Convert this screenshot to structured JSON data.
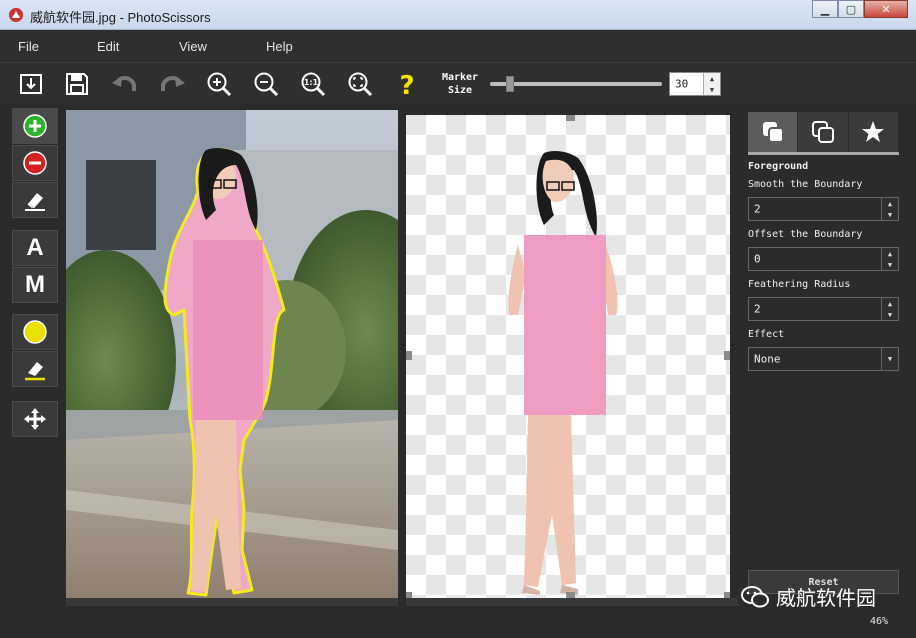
{
  "window": {
    "title": "威航软件园.jpg - PhotoScissors",
    "minimize_glyph": "▁",
    "maximize_glyph": "▢",
    "close_glyph": "✕"
  },
  "menu": {
    "items": [
      "File",
      "Edit",
      "View",
      "Help"
    ]
  },
  "toolbar": {
    "buttons": [
      "open-icon",
      "save-icon",
      "undo-icon",
      "redo-icon",
      "zoom-in-icon",
      "zoom-out-icon",
      "zoom-actual-icon",
      "fit-window-icon",
      "help-icon"
    ],
    "marker_label_line1": "Marker",
    "marker_label_line2": "Size",
    "marker_size_value": "30",
    "marker_size_fraction": 0.1
  },
  "left_tools": {
    "letter_a": "A",
    "letter_m": "M"
  },
  "side_panel": {
    "tabs": [
      "foreground-tab-icon",
      "background-tab-icon",
      "effects-tab-icon"
    ],
    "section_title": "Foreground",
    "smooth_label": "Smooth the Boundary",
    "smooth_value": "2",
    "offset_label": "Offset the Boundary",
    "offset_value": "0",
    "feather_label": "Feathering Radius",
    "feather_value": "2",
    "effect_label": "Effect",
    "effect_value": "None",
    "reset_label": "Reset"
  },
  "status": {
    "zoom": "46%"
  },
  "watermark": {
    "text": "威航软件园"
  },
  "colors": {
    "accent_green": "#2db42d",
    "accent_red": "#d42020",
    "marker_yellow": "#e8e000",
    "outline_yellow": "#f2ec1a"
  }
}
